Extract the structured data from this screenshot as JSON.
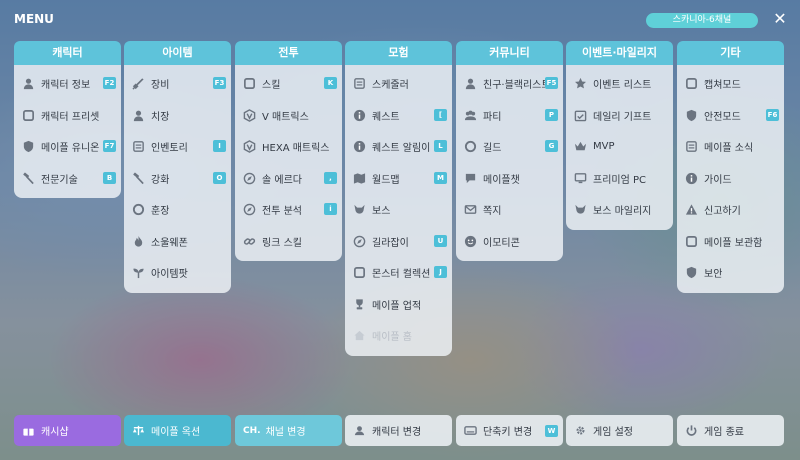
{
  "header": {
    "title": "MENU",
    "channel": "스카니아-6채널",
    "close_icon": "✕"
  },
  "columns": [
    {
      "title": "캐릭터",
      "items": [
        {
          "label": "캐릭터 정보",
          "key": "F2",
          "icon": "character-info-icon"
        },
        {
          "label": "캐릭터 프리셋",
          "key": "",
          "icon": "character-preset-icon"
        },
        {
          "label": "메이플 유니온",
          "key": "F7",
          "icon": "maple-union-icon"
        },
        {
          "label": "전문기술",
          "key": "B",
          "icon": "profession-icon"
        }
      ]
    },
    {
      "title": "아이템",
      "items": [
        {
          "label": "장비",
          "key": "F3",
          "icon": "equipment-icon"
        },
        {
          "label": "치장",
          "key": "",
          "icon": "cosmetic-icon"
        },
        {
          "label": "인벤토리",
          "key": "I",
          "icon": "inventory-icon"
        },
        {
          "label": "강화",
          "key": "O",
          "icon": "enhance-icon"
        },
        {
          "label": "훈장",
          "key": "",
          "icon": "medal-icon"
        },
        {
          "label": "소울웨폰",
          "key": "",
          "icon": "soul-weapon-icon"
        },
        {
          "label": "아이템팟",
          "key": "",
          "icon": "item-pot-icon"
        }
      ]
    },
    {
      "title": "전투",
      "items": [
        {
          "label": "스킬",
          "key": "K",
          "icon": "skill-icon"
        },
        {
          "label": "V 매트릭스",
          "key": "",
          "icon": "v-matrix-icon"
        },
        {
          "label": "HEXA 매트릭스",
          "key": "",
          "icon": "hexa-matrix-icon"
        },
        {
          "label": "솔 에르다",
          "key": ",",
          "icon": "sol-erda-icon"
        },
        {
          "label": "전투 분석",
          "key": "i",
          "icon": "combat-analysis-icon"
        },
        {
          "label": "링크 스킬",
          "key": "",
          "icon": "link-skill-icon"
        }
      ]
    },
    {
      "title": "모험",
      "items": [
        {
          "label": "스케줄러",
          "key": "",
          "icon": "scheduler-icon"
        },
        {
          "label": "퀘스트",
          "key": "[",
          "icon": "quest-icon"
        },
        {
          "label": "퀘스트 알림이",
          "key": "L",
          "icon": "quest-helper-icon"
        },
        {
          "label": "월드맵",
          "key": "M",
          "icon": "world-map-icon"
        },
        {
          "label": "보스",
          "key": "",
          "icon": "boss-icon"
        },
        {
          "label": "길라잡이",
          "key": "U",
          "icon": "guide-compass-icon"
        },
        {
          "label": "몬스터 컬렉션",
          "key": "J",
          "icon": "monster-collection-icon"
        },
        {
          "label": "메이플 업적",
          "key": "",
          "icon": "achievement-icon"
        },
        {
          "label": "메이플 홈",
          "key": "",
          "icon": "maple-home-icon",
          "disabled": true
        }
      ]
    },
    {
      "title": "커뮤니티",
      "items": [
        {
          "label": "친구·블랙리스트",
          "key": "F5",
          "icon": "friends-icon"
        },
        {
          "label": "파티",
          "key": "P",
          "icon": "party-icon"
        },
        {
          "label": "길드",
          "key": "G",
          "icon": "guild-icon"
        },
        {
          "label": "메이플챗",
          "key": "",
          "icon": "maple-chat-icon"
        },
        {
          "label": "쪽지",
          "key": "",
          "icon": "message-icon"
        },
        {
          "label": "이모티콘",
          "key": "",
          "icon": "emoticon-icon"
        }
      ]
    },
    {
      "title": "이벤트·마일리지",
      "items": [
        {
          "label": "이벤트 리스트",
          "key": "",
          "icon": "event-star-icon"
        },
        {
          "label": "데일리 기프트",
          "key": "",
          "icon": "daily-gift-icon"
        },
        {
          "label": "MVP",
          "key": "",
          "icon": "mvp-crown-icon"
        },
        {
          "label": "프리미엄 PC",
          "key": "",
          "icon": "premium-pc-icon"
        },
        {
          "label": "보스 마일리지",
          "key": "",
          "icon": "boss-mileage-icon"
        }
      ]
    },
    {
      "title": "기타",
      "items": [
        {
          "label": "캡쳐모드",
          "key": "",
          "icon": "capture-icon"
        },
        {
          "label": "안전모드",
          "key": "F6",
          "icon": "safe-mode-icon"
        },
        {
          "label": "메이플 소식",
          "key": "",
          "icon": "news-icon"
        },
        {
          "label": "가이드",
          "key": "",
          "icon": "info-icon"
        },
        {
          "label": "신고하기",
          "key": "",
          "icon": "report-icon"
        },
        {
          "label": "메이플 보관함",
          "key": "",
          "icon": "storage-icon"
        },
        {
          "label": "보안",
          "key": "",
          "icon": "security-icon"
        }
      ]
    }
  ],
  "bottom": [
    {
      "label": "캐시샵",
      "icon": "gift-icon",
      "key": "",
      "style": "purple"
    },
    {
      "label": "메이플 옥션",
      "icon": "auction-scale-icon",
      "key": "",
      "style": "teal"
    },
    {
      "label": "채널 변경",
      "tag": "CH.",
      "icon": "",
      "key": "",
      "style": "teal2"
    },
    {
      "label": "캐릭터 변경",
      "icon": "change-character-icon",
      "key": "",
      "style": ""
    },
    {
      "label": "단축키 변경",
      "icon": "keyboard-icon",
      "key": "W",
      "style": ""
    },
    {
      "label": "게임 설정",
      "icon": "gear-icon",
      "key": "",
      "style": ""
    },
    {
      "label": "게임 종료",
      "icon": "power-icon",
      "key": "",
      "style": ""
    }
  ],
  "colors": {
    "accent": "#5ec3da",
    "key_badge": "#4dbfd8",
    "cash_shop": "#9a6be0"
  }
}
